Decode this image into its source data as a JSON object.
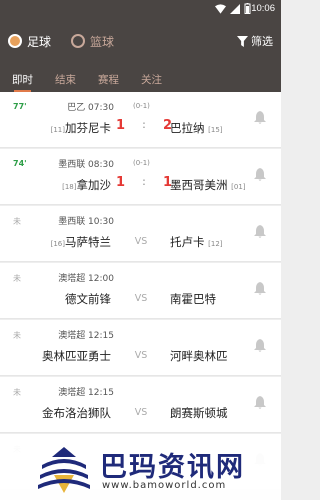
{
  "status_bar": {
    "time": "10:06"
  },
  "header": {
    "tabs": [
      {
        "label": "足球",
        "active": true
      },
      {
        "label": "篮球",
        "active": false
      }
    ],
    "filter_label": "筛选"
  },
  "subtabs": [
    {
      "label": "即时",
      "active": true
    },
    {
      "label": "结束",
      "active": false
    },
    {
      "label": "赛程",
      "active": false
    },
    {
      "label": "关注",
      "active": false
    }
  ],
  "matches": [
    {
      "status": "77'",
      "league_time": "巴乙 07:30",
      "code": "(0-1)",
      "home": "加芬尼卡",
      "home_rank": "[11]",
      "away": "巴拉纳",
      "away_rank": "[15]",
      "home_score": "1",
      "away_score": "2",
      "live": true
    },
    {
      "status": "74'",
      "league_time": "墨西联 08:30",
      "code": "(0-1)",
      "home": "拿加沙",
      "home_rank": "[18]",
      "away": "墨西哥美洲",
      "away_rank": "[01]",
      "home_score": "1",
      "away_score": "1",
      "live": true
    },
    {
      "status": "未",
      "league_time": "墨西联 10:30",
      "code": "",
      "home": "马萨特兰",
      "home_rank": "[16]",
      "away": "托卢卡",
      "away_rank": "[12]",
      "vs": "VS",
      "live": false
    },
    {
      "status": "未",
      "league_time": "澳塔超 12:00",
      "code": "",
      "home": "德文前锋",
      "home_rank": "",
      "away": "南霍巴特",
      "away_rank": "",
      "vs": "VS",
      "live": false
    },
    {
      "status": "未",
      "league_time": "澳塔超 12:15",
      "code": "",
      "home": "奥林匹亚勇士",
      "home_rank": "",
      "away": "河畔奥林匹",
      "away_rank": "",
      "vs": "VS",
      "live": false
    },
    {
      "status": "未",
      "league_time": "澳塔超 12:15",
      "code": "",
      "home": "金布洛治狮队",
      "home_rank": "",
      "away": "朗赛斯顿城",
      "away_rank": "",
      "vs": "VS",
      "live": false
    },
    {
      "status": "未",
      "league_time": "",
      "code": "",
      "home": "",
      "home_rank": "",
      "away": "",
      "away_rank": "",
      "vs": "",
      "live": false
    }
  ],
  "watermark": {
    "title": "巴玛资讯网",
    "url": "www.bamoworld.com"
  },
  "colors": {
    "header_bg": "#4a4543",
    "accent": "#e07a4a",
    "score_red": "#e53935",
    "live_green": "#2e9e48"
  }
}
